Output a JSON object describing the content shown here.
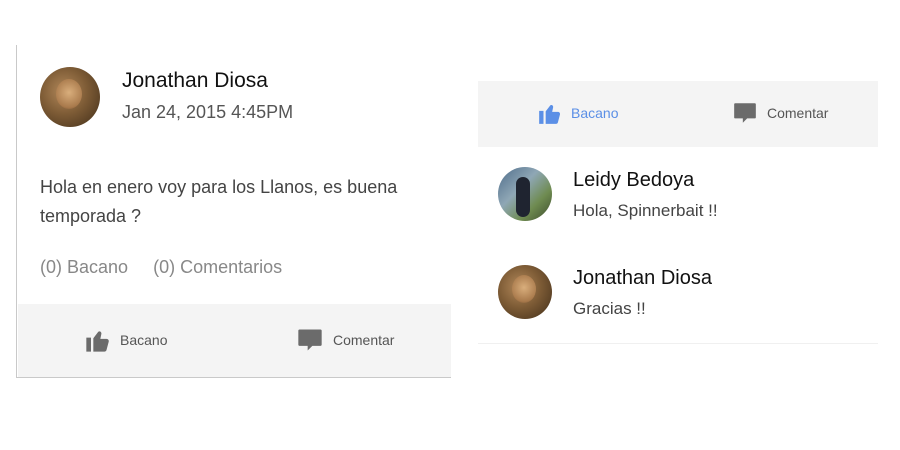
{
  "post": {
    "author": "Jonathan Diosa",
    "timestamp": "Jan 24, 2015 4:45PM",
    "text": "Hola en enero voy para los Llanos, es buena temporada ?",
    "stats": {
      "likes": "(0) Bacano",
      "comments": "(0) Comentarios"
    },
    "actions": {
      "like_label": "Bacano",
      "comment_label": "Comentar"
    }
  },
  "comments_panel": {
    "actions": {
      "like_label": "Bacano",
      "comment_label": "Comentar",
      "like_active": true
    },
    "comments": [
      {
        "author": "Leidy Bedoya",
        "text": "Hola, Spinnerbait !!"
      },
      {
        "author": "Jonathan Diosa",
        "text": "Gracias !!"
      }
    ]
  },
  "colors": {
    "like_active": "#5b8fe6",
    "icon_gray": "#6b6b6b",
    "action_bar_bg": "#f4f4f4"
  },
  "icons": [
    "thumbs-up-icon",
    "comment-bubble-icon"
  ]
}
